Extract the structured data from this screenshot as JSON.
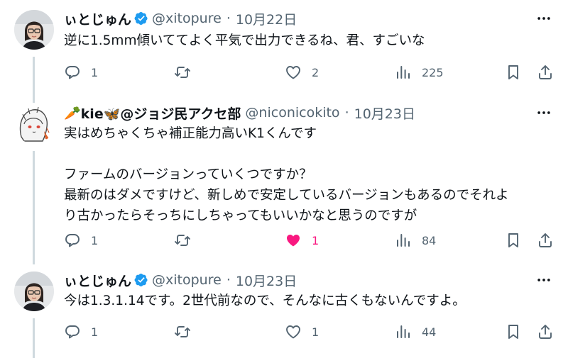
{
  "tweets": [
    {
      "name": "ぃとじゅん",
      "verified": true,
      "handle": "@xitopure",
      "separator": "·",
      "date": "10月22日",
      "lines": [
        "逆に1.5mm傾いててよく平気で出力できるね、君、すごいな"
      ],
      "counts": {
        "reply": "1",
        "retweet": "",
        "like": "2",
        "views": "225"
      },
      "liked": false,
      "icons": {
        "more": "more-icon",
        "reply": "reply-icon",
        "retweet": "retweet-icon",
        "like": "heart-icon",
        "views": "views-icon",
        "bookmark": "bookmark-icon",
        "share": "share-icon"
      }
    },
    {
      "name_prefix": "🥕",
      "name": "kie🦋@ジョジ民アクセ部",
      "verified": false,
      "handle": "@niconicokito",
      "separator": "·",
      "date": "10月23日",
      "lines": [
        "実はめちゃくちゃ補正能力高いK1くんです",
        "",
        "ファームのバージョンっていくつですか？",
        "最新のはダメですけど、新しめで安定しているバージョンもあるのでそれよ",
        "り古かったらそっちにしちゃってもいいかなと思うのですが"
      ],
      "counts": {
        "reply": "1",
        "retweet": "",
        "like": "1",
        "views": "84"
      },
      "liked": true,
      "icons": {
        "more": "more-icon",
        "reply": "reply-icon",
        "retweet": "retweet-icon",
        "like": "heart-filled-icon",
        "views": "views-icon",
        "bookmark": "bookmark-icon",
        "share": "share-icon"
      }
    },
    {
      "name": "ぃとじゅん",
      "verified": true,
      "handle": "@xitopure",
      "separator": "·",
      "date": "10月23日",
      "lines": [
        "今は1.3.1.14です。2世代前なので、そんなに古くもないんですよ。"
      ],
      "counts": {
        "reply": "1",
        "retweet": "",
        "like": "1",
        "views": "44"
      },
      "liked": false,
      "icons": {
        "more": "more-icon",
        "reply": "reply-icon",
        "retweet": "retweet-icon",
        "like": "heart-icon",
        "views": "views-icon",
        "bookmark": "bookmark-icon",
        "share": "share-icon"
      }
    }
  ],
  "colors": {
    "text": "#0f1419",
    "secondary": "#536471",
    "verified": "#1d9bf0",
    "like_active": "#f91880",
    "thread_line": "#cfd9de"
  }
}
